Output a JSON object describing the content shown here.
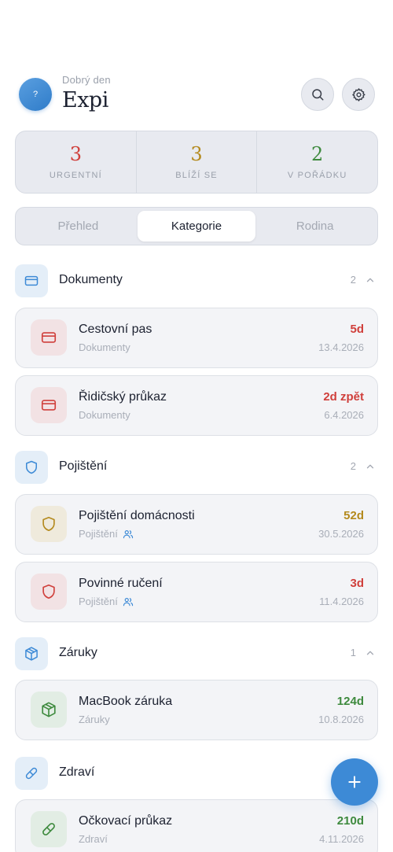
{
  "header": {
    "avatar_label": "?",
    "greeting": "Dobrý den",
    "app_name": "Expi",
    "search_icon": "search-icon",
    "settings_icon": "gear-icon"
  },
  "stats": [
    {
      "value": "3",
      "label": "URGENTNÍ",
      "color": "#d0403c"
    },
    {
      "value": "3",
      "label": "BLÍŽÍ SE",
      "color": "#b48a1e"
    },
    {
      "value": "2",
      "label": "V POŘÁDKU",
      "color": "#3e8a3e"
    }
  ],
  "tabs": [
    {
      "label": "Přehled",
      "active": false
    },
    {
      "label": "Kategorie",
      "active": true
    },
    {
      "label": "Rodina",
      "active": false
    }
  ],
  "sections": [
    {
      "title": "Dokumenty",
      "count": "2",
      "icon": "card-icon",
      "expanded": true,
      "items": [
        {
          "title": "Cestovní pas",
          "category": "Dokumenty",
          "shared": false,
          "days": "5d",
          "date": "13.4.2026",
          "status": "red",
          "icon": "card-icon"
        },
        {
          "title": "Řidičský průkaz",
          "category": "Dokumenty",
          "shared": false,
          "days": "2d zpět",
          "date": "6.4.2026",
          "status": "red",
          "icon": "card-icon"
        }
      ]
    },
    {
      "title": "Pojištění",
      "count": "2",
      "icon": "shield-icon",
      "expanded": true,
      "items": [
        {
          "title": "Pojištění domácnosti",
          "category": "Pojištění",
          "shared": true,
          "days": "52d",
          "date": "30.5.2026",
          "status": "amber",
          "icon": "shield-icon"
        },
        {
          "title": "Povinné ručení",
          "category": "Pojištění",
          "shared": true,
          "days": "3d",
          "date": "11.4.2026",
          "status": "red",
          "icon": "shield-icon"
        }
      ]
    },
    {
      "title": "Záruky",
      "count": "1",
      "icon": "box-icon",
      "expanded": true,
      "items": [
        {
          "title": "MacBook záruka",
          "category": "Záruky",
          "shared": false,
          "days": "124d",
          "date": "10.8.2026",
          "status": "green",
          "icon": "box-icon"
        }
      ]
    },
    {
      "title": "Zdraví",
      "count": "",
      "icon": "pill-icon",
      "expanded": true,
      "items": [
        {
          "title": "Očkovací průkaz",
          "category": "Zdraví",
          "shared": false,
          "days": "210d",
          "date": "4.11.2026",
          "status": "green",
          "icon": "pill-icon"
        }
      ]
    }
  ],
  "fab": {
    "icon": "plus-icon"
  },
  "colors": {
    "accent": "#3d8ad6",
    "red": "#d0403c",
    "amber": "#b48a1e",
    "green": "#3e8a3e"
  }
}
